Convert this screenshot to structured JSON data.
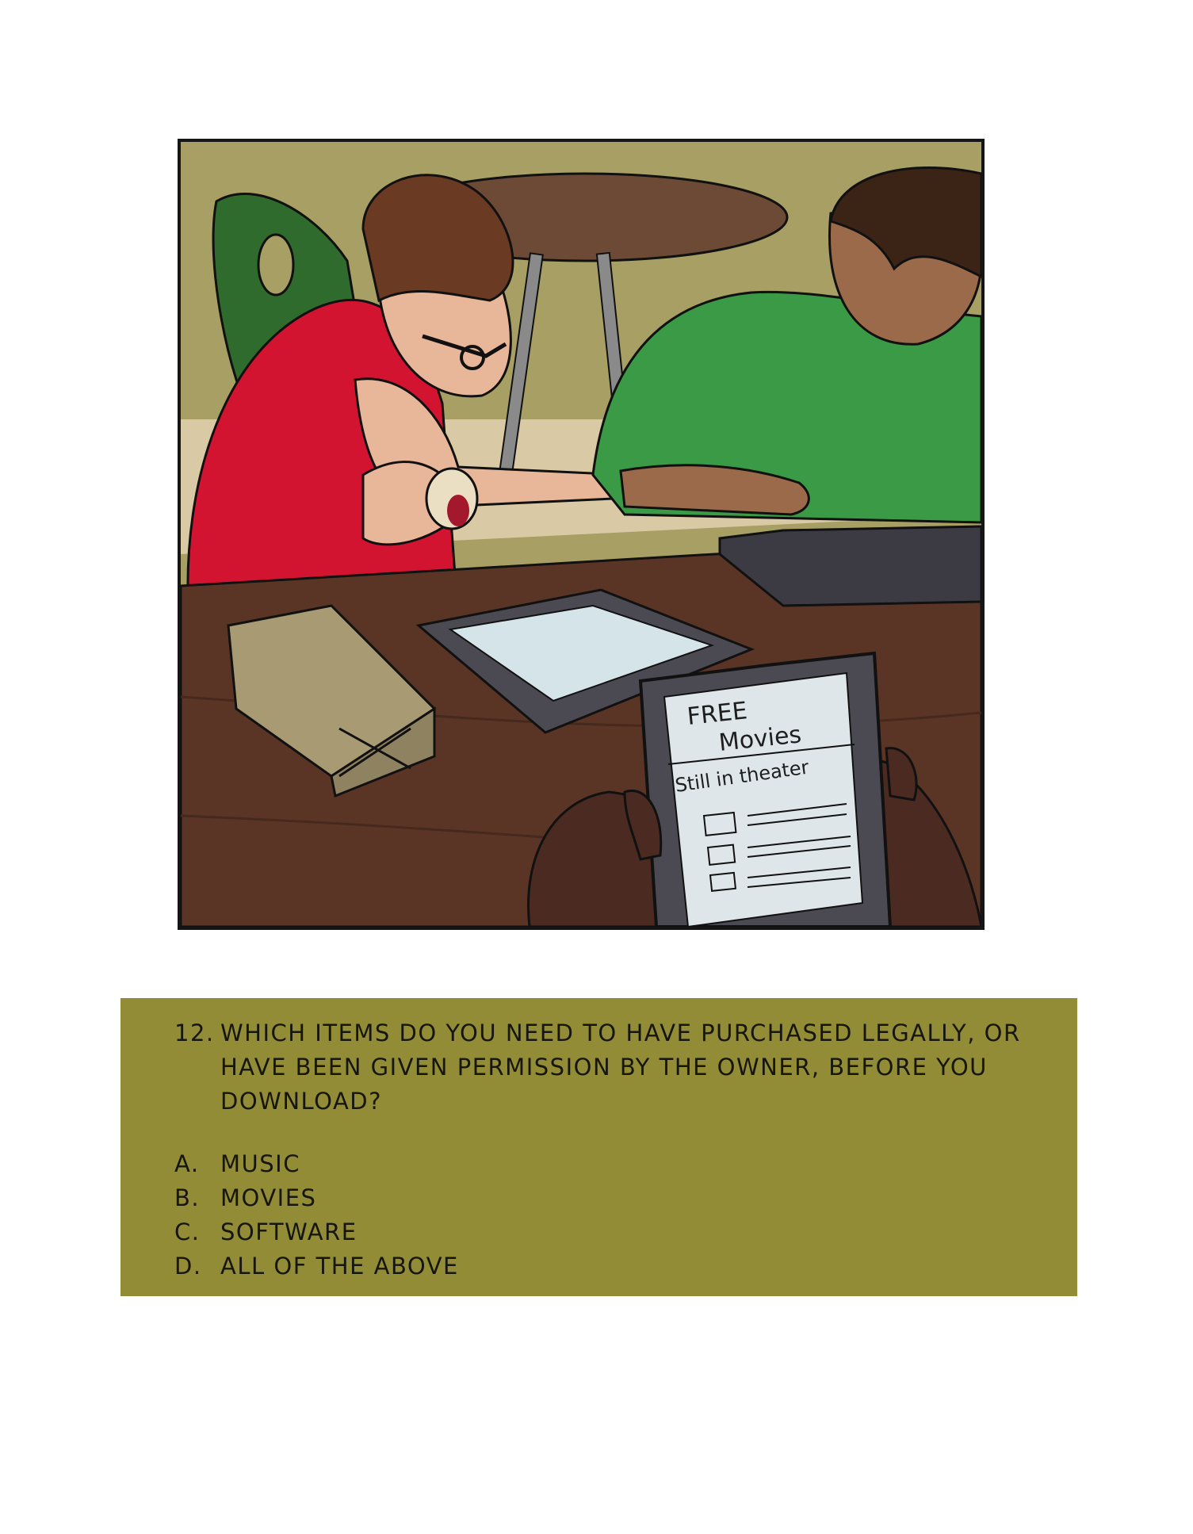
{
  "illustration": {
    "tablet_screen": {
      "line1": "FREE",
      "line2": "Movies",
      "line3": "Still in theater"
    }
  },
  "question": {
    "number": "12.",
    "text": "WHICH ITEMS DO YOU NEED TO HAVE PURCHASED LEGALLY, OR HAVE BEEN GIVEN PERMISSION BY THE OWNER, BEFORE YOU DOWNLOAD?",
    "options": [
      {
        "letter": "A.",
        "label": "MUSIC"
      },
      {
        "letter": "B.",
        "label": "MOVIES"
      },
      {
        "letter": "C.",
        "label": "SOFTWARE"
      },
      {
        "letter": "D.",
        "label": "ALL OF THE ABOVE"
      }
    ]
  },
  "colors": {
    "question_background": "#928c37",
    "panel_wall": "#a79f63",
    "table": "#5a3526",
    "red_shirt": "#d21431",
    "green_shirt": "#3a9a45"
  }
}
